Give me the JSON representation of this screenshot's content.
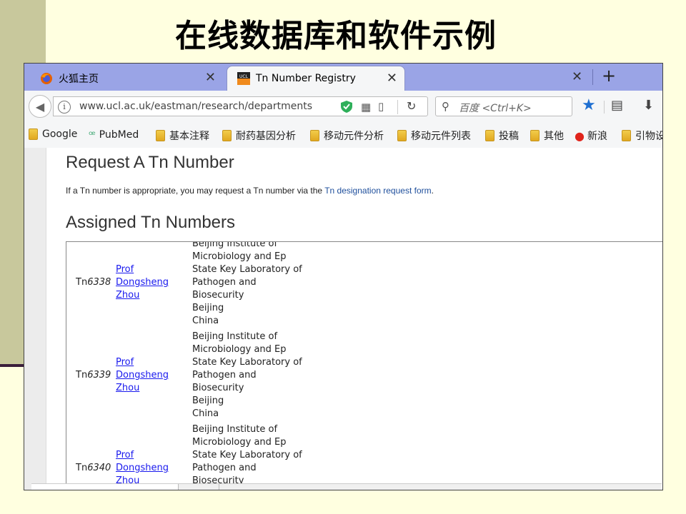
{
  "slide": {
    "title": "在线数据库和软件示例"
  },
  "browser": {
    "tabs": [
      {
        "label": "火狐主页",
        "icon": "firefox-icon",
        "active": false
      },
      {
        "label": "Tn Number Registry",
        "icon": "ucl-icon",
        "active": true
      }
    ],
    "url": "www.ucl.ac.uk/eastman/research/departments",
    "search_placeholder": "百度 <Ctrl+K>",
    "bookmarks": [
      {
        "label": "Google",
        "icon": "folder-icon"
      },
      {
        "label": "PubMed",
        "icon": "pubmed-icon"
      },
      {
        "label": "基本注释",
        "icon": "folder-icon"
      },
      {
        "label": "耐药基因分析",
        "icon": "folder-icon"
      },
      {
        "label": "移动元件分析",
        "icon": "folder-icon"
      },
      {
        "label": "移动元件列表",
        "icon": "folder-icon"
      },
      {
        "label": "投稿",
        "icon": "folder-icon"
      },
      {
        "label": "其他",
        "icon": "folder-icon"
      },
      {
        "label": "新浪",
        "icon": "weibo-icon"
      },
      {
        "label": "引物设",
        "icon": "folder-icon"
      }
    ],
    "colors": {
      "tabbar": "#9aa4e6",
      "star": "#1f6fd1",
      "link": "#1f4f9c"
    }
  },
  "page": {
    "request_heading": "Request A Tn Number",
    "request_text": "If a Tn number is appropriate, you may request a Tn number via the ",
    "request_link": "Tn designation request form",
    "request_suffix": ".",
    "assigned_heading": "Assigned Tn Numbers",
    "rows": [
      {
        "tn_prefix": "Tn",
        "tn_number": "6338",
        "person_lines": [
          "Prof",
          "Dongsheng",
          "Zhou"
        ],
        "institution_lines": [
          "Beijing Institute of",
          "Microbiology and Ep",
          "State Key Laboratory of",
          "Pathogen and",
          "Biosecurity",
          "Beijing",
          "China"
        ]
      },
      {
        "tn_prefix": "Tn",
        "tn_number": "6339",
        "person_lines": [
          "Prof",
          "Dongsheng",
          "Zhou"
        ],
        "institution_lines": [
          "Beijing Institute of",
          "Microbiology and Ep",
          "State Key Laboratory of",
          "Pathogen and",
          "Biosecurity",
          "Beijing",
          "China"
        ]
      },
      {
        "tn_prefix": "Tn",
        "tn_number": "6340",
        "person_lines": [
          "Prof",
          "Dongsheng",
          "Zhou"
        ],
        "institution_lines": [
          "Beijing Institute of",
          "Microbiology and Ep",
          "State Key Laboratory of",
          "Pathogen and",
          "Biosecurity"
        ]
      }
    ]
  }
}
